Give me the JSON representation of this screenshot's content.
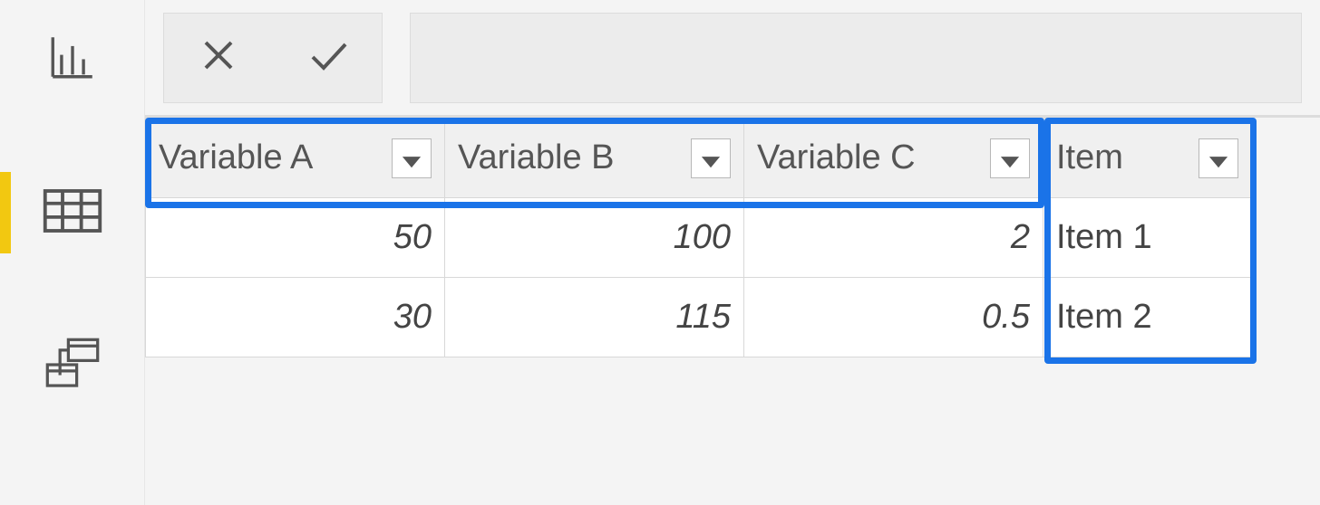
{
  "nav": {
    "report_icon": "report",
    "data_icon": "data",
    "model_icon": "model"
  },
  "formula_bar": {
    "cancel": "✕",
    "accept": "✓",
    "value": ""
  },
  "table": {
    "columns": [
      {
        "label": "Variable A",
        "type": "num"
      },
      {
        "label": "Variable B",
        "type": "num"
      },
      {
        "label": "Variable C",
        "type": "num"
      },
      {
        "label": "Item",
        "type": "txt"
      }
    ],
    "rows": [
      {
        "a": "50",
        "b": "100",
        "c": "2",
        "d": "Item 1"
      },
      {
        "a": "30",
        "b": "115",
        "c": "0.5",
        "d": "Item 2"
      }
    ]
  }
}
